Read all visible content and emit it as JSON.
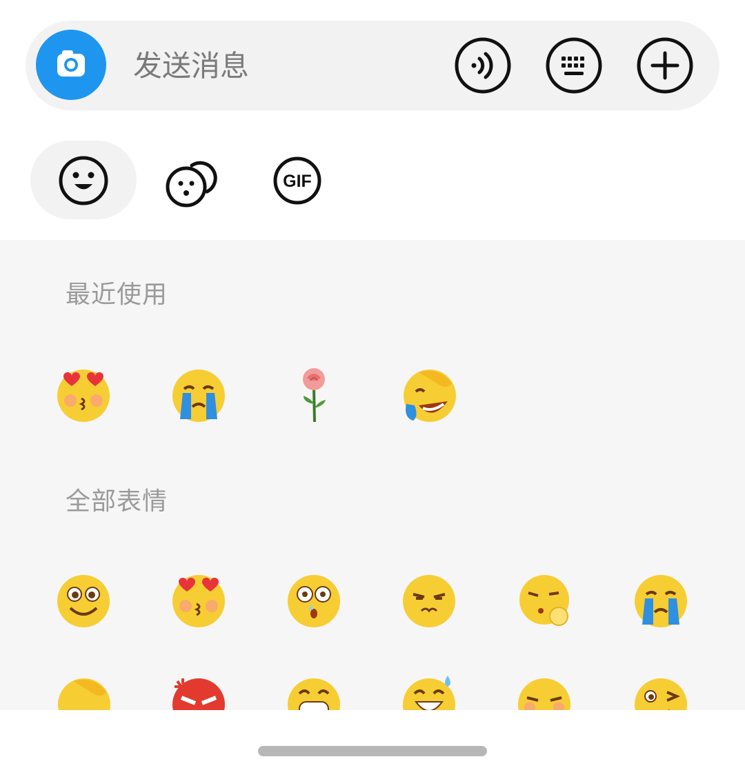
{
  "composer": {
    "placeholder": "发送消息",
    "camera_icon": "camera-icon",
    "voice_icon": "voice-icon",
    "keyboard_icon": "keyboard-icon",
    "add_icon": "plus-icon",
    "accent_color": "#1e96f0"
  },
  "tabs": [
    {
      "icon": "smiley-icon",
      "active": true
    },
    {
      "icon": "sticker-faces-icon",
      "active": false
    },
    {
      "icon": "gif-icon",
      "label": "GIF",
      "active": false
    }
  ],
  "sections": {
    "recent": {
      "title": "最近使用",
      "emojis": [
        "heart-eyes-kiss",
        "crying",
        "rose",
        "laugh-cry-facepalm"
      ]
    },
    "all": {
      "title": "全部表情",
      "emojis": [
        "goofy-smile",
        "heart-eyes-kiss",
        "shocked-drool",
        "annoyed",
        "shush-smirk",
        "crying",
        "laugh-cry-facepalm",
        "angry",
        "grin-teeth",
        "sweat-grin",
        "sleepy-blush",
        "wink-tongue"
      ]
    }
  }
}
